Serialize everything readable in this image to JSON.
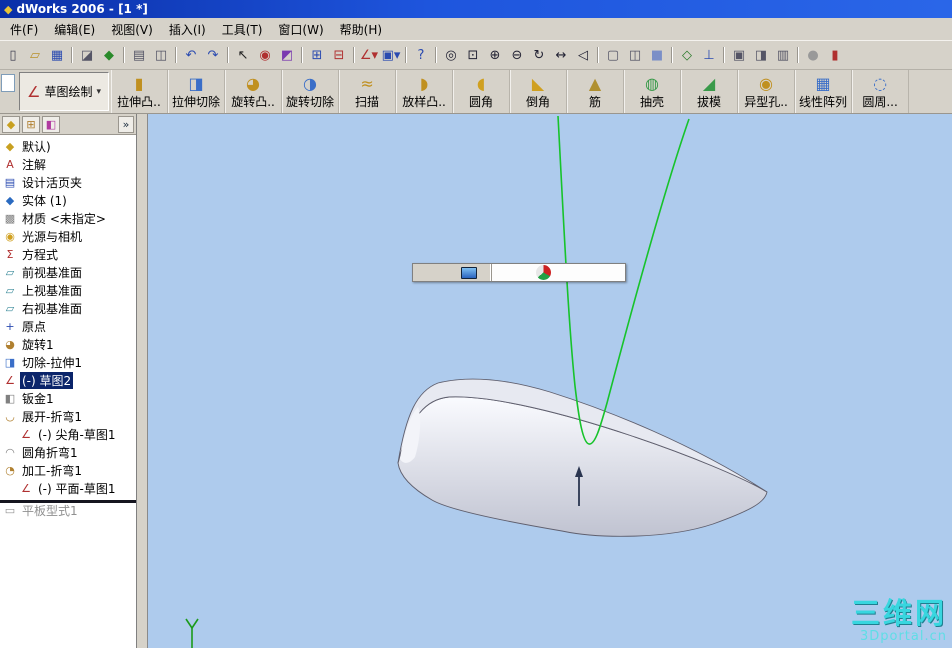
{
  "window": {
    "title": "dWorks 2006 - [1 *]",
    "app_icon": "◆"
  },
  "menubar": {
    "items": [
      {
        "name": "menu-file",
        "label": "件(F)"
      },
      {
        "name": "menu-edit",
        "label": "编辑(E)"
      },
      {
        "name": "menu-view",
        "label": "视图(V)"
      },
      {
        "name": "menu-insert",
        "label": "插入(I)"
      },
      {
        "name": "menu-tools",
        "label": "工具(T)"
      },
      {
        "name": "menu-window",
        "label": "窗口(W)"
      },
      {
        "name": "menu-help",
        "label": "帮助(H)"
      }
    ]
  },
  "toolbar1": {
    "icons": [
      {
        "name": "new-document-icon",
        "glyph": "▯",
        "color": "#444455"
      },
      {
        "name": "open-icon",
        "glyph": "▱",
        "color": "#b8902a"
      },
      {
        "name": "save-icon",
        "glyph": "▦",
        "color": "#2a4ab0"
      },
      {
        "name": "make-drawing-icon",
        "glyph": "◪",
        "color": "#555566",
        "sep": true
      },
      {
        "name": "make-assembly-icon",
        "glyph": "◆",
        "color": "#2a8a2a"
      },
      {
        "name": "print-icon",
        "glyph": "▤",
        "color": "#555566",
        "sep": true
      },
      {
        "name": "print-preview-icon",
        "glyph": "◫",
        "color": "#555566"
      },
      {
        "name": "undo-icon",
        "glyph": "↶",
        "color": "#2a4ab0",
        "sep": true
      },
      {
        "name": "redo-icon",
        "glyph": "↷",
        "color": "#2a4ab0"
      },
      {
        "name": "select-icon",
        "glyph": "↖",
        "color": "#222222",
        "sep": true
      },
      {
        "name": "rebuild-icon",
        "glyph": "◉",
        "color": "#b03030"
      },
      {
        "name": "edit-color-icon",
        "glyph": "◩",
        "color": "#7a3ab0"
      },
      {
        "name": "texture-icon",
        "glyph": "⊞",
        "color": "#2a4ab0",
        "sep": true
      },
      {
        "name": "options-icon",
        "glyph": "⊟",
        "color": "#b03030"
      },
      {
        "name": "sketch-dropdown-icon",
        "glyph": "∠▾",
        "color": "#b03030",
        "sep": true
      },
      {
        "name": "reference-dropdown-icon",
        "glyph": "▣▾",
        "color": "#2a4ab0"
      },
      {
        "name": "help-icon",
        "glyph": "?",
        "color": "#2a4ab0",
        "sep": true
      },
      {
        "name": "zoom-fit-icon",
        "glyph": "◎",
        "color": "#222233",
        "sep": true
      },
      {
        "name": "zoom-area-icon",
        "glyph": "⊡",
        "color": "#222233"
      },
      {
        "name": "zoom-in-icon",
        "glyph": "⊕",
        "color": "#222233"
      },
      {
        "name": "zoom-out-icon",
        "glyph": "⊖",
        "color": "#222233"
      },
      {
        "name": "rotate-view-icon",
        "glyph": "↻",
        "color": "#222233"
      },
      {
        "name": "pan-icon",
        "glyph": "↔",
        "color": "#222233"
      },
      {
        "name": "previous-view-icon",
        "glyph": "◁",
        "color": "#222233"
      },
      {
        "name": "wireframe-icon",
        "glyph": "▢",
        "color": "#555566",
        "sep": true
      },
      {
        "name": "hidden-lines-icon",
        "glyph": "◫",
        "color": "#555566"
      },
      {
        "name": "shaded-icon",
        "glyph": "■",
        "color": "#7b8fc7"
      },
      {
        "name": "view-orientation-icon",
        "glyph": "◇",
        "color": "#2a7a2a",
        "sep": true
      },
      {
        "name": "normal-to-icon",
        "glyph": "⊥",
        "color": "#2a4ab0"
      },
      {
        "name": "tile-window-icon",
        "glyph": "▣",
        "color": "#555566",
        "sep": true
      },
      {
        "name": "split-window-icon",
        "glyph": "◨",
        "color": "#555566"
      },
      {
        "name": "full-screen-icon",
        "glyph": "▥",
        "color": "#555566"
      },
      {
        "name": "record-icon",
        "glyph": "●",
        "color": "#999999",
        "sep": true
      },
      {
        "name": "partial-toolbar-icon",
        "glyph": "▮",
        "color": "#b03030"
      }
    ]
  },
  "toolbar2": {
    "sketch": {
      "label": "草图绘制",
      "glyph": "∠",
      "color": "#b03030",
      "arrow": "▾"
    },
    "features": [
      {
        "name": "feature-extrude-boss",
        "label": "拉伸凸..",
        "glyph": "▮",
        "color": "#c09020"
      },
      {
        "name": "feature-extrude-cut",
        "label": "拉伸切除",
        "glyph": "◨",
        "color": "#3a6ec8"
      },
      {
        "name": "feature-revolve-boss",
        "label": "旋转凸..",
        "glyph": "◕",
        "color": "#c09020"
      },
      {
        "name": "feature-revolve-cut",
        "label": "旋转切除",
        "glyph": "◑",
        "color": "#3a6ec8"
      },
      {
        "name": "feature-sweep",
        "label": "扫描",
        "glyph": "≈",
        "color": "#c09020"
      },
      {
        "name": "feature-loft",
        "label": "放样凸..",
        "glyph": "◗",
        "color": "#c09020"
      },
      {
        "name": "feature-fillet",
        "label": "圆角",
        "glyph": "◖",
        "color": "#d0a020"
      },
      {
        "name": "feature-chamfer",
        "label": "倒角",
        "glyph": "◣",
        "color": "#d0a020"
      },
      {
        "name": "feature-rib",
        "label": "筋",
        "glyph": "▲",
        "color": "#b09030"
      },
      {
        "name": "feature-shell",
        "label": "抽壳",
        "glyph": "◍",
        "color": "#3a9a4a"
      },
      {
        "name": "feature-draft",
        "label": "拔模",
        "glyph": "◢",
        "color": "#3a9a4a"
      },
      {
        "name": "feature-hole-wizard",
        "label": "异型孔..",
        "glyph": "◉",
        "color": "#c09020"
      },
      {
        "name": "feature-linear-pattern",
        "label": "线性阵列",
        "glyph": "▦",
        "color": "#3a6ec8"
      },
      {
        "name": "feature-circular-pattern",
        "label": "圆周...",
        "glyph": "◌",
        "color": "#3a6ec8"
      }
    ]
  },
  "tree": {
    "chevron": "»",
    "tabs": [
      {
        "name": "feature-manager-tab",
        "glyph": "◆",
        "color": "#c8a020"
      },
      {
        "name": "property-manager-tab",
        "glyph": "⊞",
        "color": "#b08030"
      },
      {
        "name": "configuration-manager-tab",
        "glyph": "◧",
        "color": "#b03aa0"
      }
    ],
    "items": [
      {
        "name": "tree-item-part",
        "label": "默认)",
        "glyph": "◆",
        "color": "#c8a020"
      },
      {
        "name": "tree-item-annotations",
        "label": "注解",
        "glyph": "A",
        "color": "#b03030"
      },
      {
        "name": "tree-item-design-binder",
        "label": "设计活页夹",
        "glyph": "▤",
        "color": "#2a4ab0"
      },
      {
        "name": "tree-item-solid-bodies",
        "label": "实体 (1)",
        "glyph": "◆",
        "color": "#2a6ac0"
      },
      {
        "name": "tree-item-material",
        "label": "材质 <未指定>",
        "glyph": "▩",
        "color": "#808080"
      },
      {
        "name": "tree-item-lights-cameras",
        "label": "光源与相机",
        "glyph": "◉",
        "color": "#d0a020"
      },
      {
        "name": "tree-item-equations",
        "label": "方程式",
        "glyph": "Σ",
        "color": "#b03030"
      },
      {
        "name": "tree-item-front-plane",
        "label": "前视基准面",
        "glyph": "▱",
        "color": "#3a8a9a"
      },
      {
        "name": "tree-item-top-plane",
        "label": "上视基准面",
        "glyph": "▱",
        "color": "#3a8a9a"
      },
      {
        "name": "tree-item-right-plane",
        "label": "右视基准面",
        "glyph": "▱",
        "color": "#3a8a9a"
      },
      {
        "name": "tree-item-origin",
        "label": "原点",
        "glyph": "+",
        "color": "#2a4ab0"
      },
      {
        "name": "tree-item-revolve1",
        "label": "旋转1",
        "glyph": "◕",
        "color": "#b08030"
      },
      {
        "name": "tree-item-cut-extrude1",
        "label": "切除-拉伸1",
        "glyph": "◨",
        "color": "#3a6ec8"
      },
      {
        "name": "tree-item-sketch2",
        "label": "(-) 草图2",
        "glyph": "∠",
        "color": "#b03030",
        "selected": true
      },
      {
        "name": "tree-item-sheet-metal1",
        "label": "钣金1",
        "glyph": "◧",
        "color": "#808080"
      },
      {
        "name": "tree-item-flatten-bends1",
        "label": "展开-折弯1",
        "glyph": "◡",
        "color": "#b08030"
      },
      {
        "name": "tree-item-sharp-sketch1",
        "label": "(-) 尖角-草图1",
        "glyph": "∠",
        "color": "#b03030",
        "indent": true
      },
      {
        "name": "tree-item-round-bend1",
        "label": "圆角折弯1",
        "glyph": "◠",
        "color": "#808080"
      },
      {
        "name": "tree-item-process-bends1",
        "label": "加工-折弯1",
        "glyph": "◔",
        "color": "#b08030"
      },
      {
        "name": "tree-item-flat-sketch1",
        "label": "(-) 平面-草图1",
        "glyph": "∠",
        "color": "#b03030",
        "indent": true
      },
      {
        "name": "tree-item-flat-pattern1",
        "label": "平板型式1",
        "glyph": "▭",
        "color": "#909090",
        "dim": true,
        "rollback_above": true
      }
    ]
  },
  "viewport": {
    "watermark": {
      "line1": "三维网",
      "line2": "3Dportal.cn"
    }
  }
}
